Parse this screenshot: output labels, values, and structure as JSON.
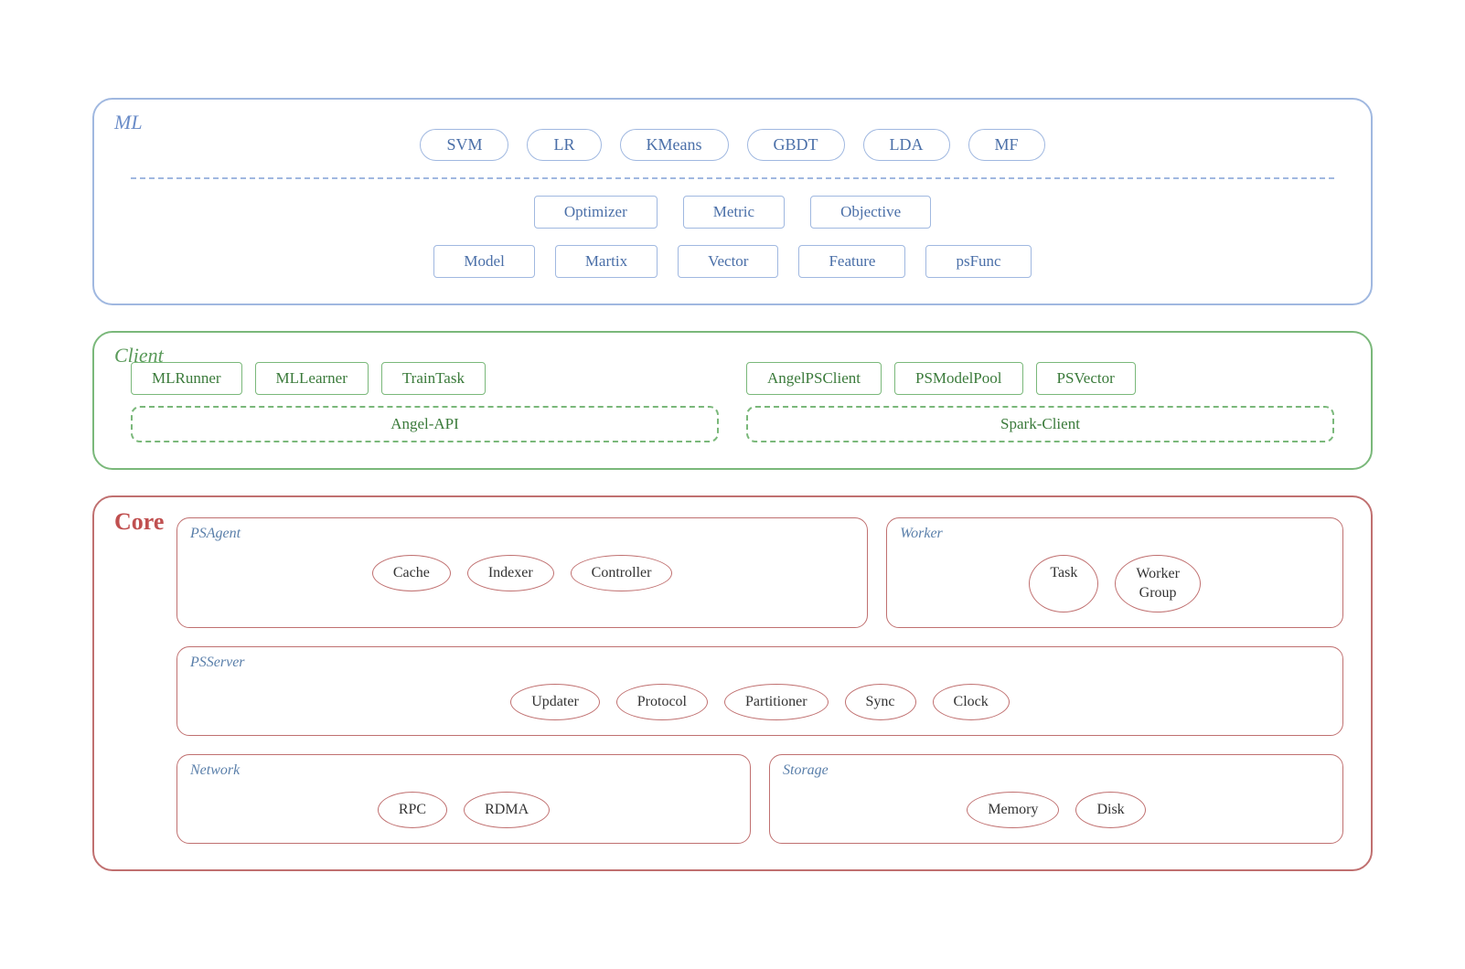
{
  "ml": {
    "label": "ML",
    "top_row": [
      "SVM",
      "LR",
      "KMeans",
      "GBDT",
      "LDA",
      "MF"
    ],
    "mid_row": [
      "Optimizer",
      "Metric",
      "Objective"
    ],
    "bottom_row": [
      "Model",
      "Martix",
      "Vector",
      "Feature",
      "psFunc"
    ]
  },
  "client": {
    "label": "Client",
    "left_boxes": [
      "MLRunner",
      "MLLearner",
      "TrainTask"
    ],
    "right_boxes": [
      "AngelPSClient",
      "PSModelPool",
      "PSVector"
    ],
    "left_api": "Angel-API",
    "right_api": "Spark-Client"
  },
  "core": {
    "label": "Core",
    "psagent": {
      "label": "PSAgent",
      "items": [
        "Cache",
        "Indexer",
        "Controller"
      ]
    },
    "worker": {
      "label": "Worker",
      "items": [
        "Task",
        "Worker\nGroup"
      ]
    },
    "psserver": {
      "label": "PSServer",
      "items": [
        "Updater",
        "Protocol",
        "Partitioner",
        "Sync",
        "Clock"
      ]
    },
    "network": {
      "label": "Network",
      "items": [
        "RPC",
        "RDMA"
      ]
    },
    "storage": {
      "label": "Storage",
      "items": [
        "Memory",
        "Disk"
      ]
    }
  }
}
